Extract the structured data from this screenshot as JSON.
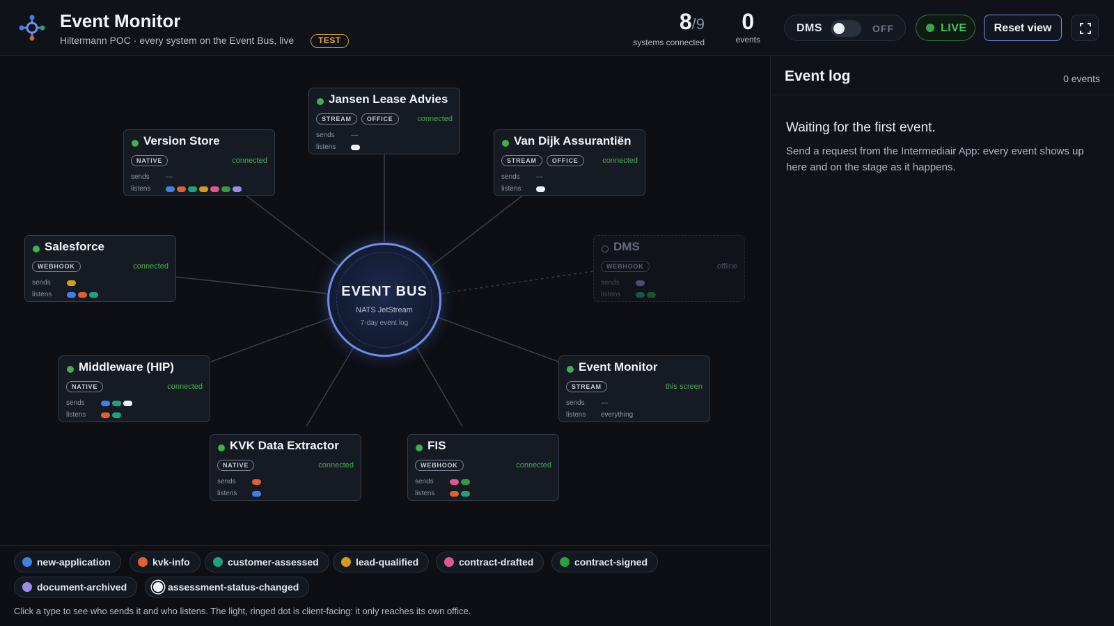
{
  "header": {
    "title": "Event Monitor",
    "subtitle": "Hiltermann POC · every system on the Event Bus, live",
    "env_badge": "TEST",
    "systems_connected": "8",
    "systems_total": "/9",
    "systems_label": "systems connected",
    "events_count": "0",
    "events_label": "events",
    "dms_label": "DMS",
    "dms_state": "OFF",
    "live_label": "LIVE",
    "reset_label": "Reset view"
  },
  "colors": {
    "new-application": "#3b82e6",
    "kvk-info": "#e0602e",
    "customer-assessed": "#1fa37e",
    "lead-qualified": "#d69b1e",
    "contract-drafted": "#e0578f",
    "contract-signed": "#2f9e3f",
    "document-archived": "#9b8be8",
    "assessment-status-changed": "#f2f4f8"
  },
  "bus": {
    "title": "EVENT BUS",
    "subtitle": "NATS JetStream",
    "retention": "7-day event log"
  },
  "row_labels": {
    "sends": "sends",
    "listens": "listens"
  },
  "nodes": [
    {
      "name": "Jansen Lease Advies",
      "tags": [
        "STREAM",
        "OFFICE"
      ],
      "status": "connected",
      "sends_text": "—",
      "sends": [],
      "listens": [
        "assessment-status-changed"
      ]
    },
    {
      "name": "Version Store",
      "tags": [
        "NATIVE"
      ],
      "status": "connected",
      "sends_text": "—",
      "sends": [],
      "listens": [
        "new-application",
        "kvk-info",
        "customer-assessed",
        "lead-qualified",
        "contract-drafted",
        "contract-signed",
        "document-archived"
      ]
    },
    {
      "name": "Van Dijk Assurantiën",
      "tags": [
        "STREAM",
        "OFFICE"
      ],
      "status": "connected",
      "sends_text": "—",
      "sends": [],
      "listens": [
        "assessment-status-changed"
      ]
    },
    {
      "name": "Salesforce",
      "tags": [
        "WEBHOOK"
      ],
      "status": "connected",
      "sends": [
        "lead-qualified"
      ],
      "listens": [
        "new-application",
        "kvk-info",
        "customer-assessed"
      ]
    },
    {
      "name": "DMS",
      "tags": [
        "WEBHOOK"
      ],
      "status": "offline",
      "sends": [
        "document-archived"
      ],
      "listens": [
        "customer-assessed",
        "contract-signed"
      ]
    },
    {
      "name": "Middleware (HIP)",
      "tags": [
        "NATIVE"
      ],
      "status": "connected",
      "sends": [
        "new-application",
        "customer-assessed",
        "assessment-status-changed"
      ],
      "listens": [
        "kvk-info",
        "customer-assessed"
      ]
    },
    {
      "name": "Event Monitor",
      "tags": [
        "STREAM"
      ],
      "status": "this screen",
      "sends_text": "—",
      "listens_text": "everything"
    },
    {
      "name": "KVK Data Extractor",
      "tags": [
        "NATIVE"
      ],
      "status": "connected",
      "sends": [
        "kvk-info"
      ],
      "listens": [
        "new-application"
      ]
    },
    {
      "name": "FIS",
      "tags": [
        "WEBHOOK"
      ],
      "status": "connected",
      "sends": [
        "contract-drafted",
        "contract-signed"
      ],
      "listens": [
        "kvk-info",
        "customer-assessed"
      ]
    }
  ],
  "legend": {
    "types": [
      {
        "key": "new-application",
        "label": "new-application"
      },
      {
        "key": "kvk-info",
        "label": "kvk-info"
      },
      {
        "key": "customer-assessed",
        "label": "customer-assessed"
      },
      {
        "key": "lead-qualified",
        "label": "lead-qualified"
      },
      {
        "key": "contract-drafted",
        "label": "contract-drafted"
      },
      {
        "key": "contract-signed",
        "label": "contract-signed"
      },
      {
        "key": "document-archived",
        "label": "document-archived"
      },
      {
        "key": "assessment-status-changed",
        "label": "assessment-status-changed"
      }
    ],
    "help": "Click a type to see who sends it and who listens. The light, ringed dot is client-facing: it only reaches its own office."
  },
  "log": {
    "title": "Event log",
    "count": "0 events",
    "waiting": "Waiting for the first event.",
    "hint": "Send a request from the Intermediair App: every event shows up here and on the stage as it happens."
  }
}
